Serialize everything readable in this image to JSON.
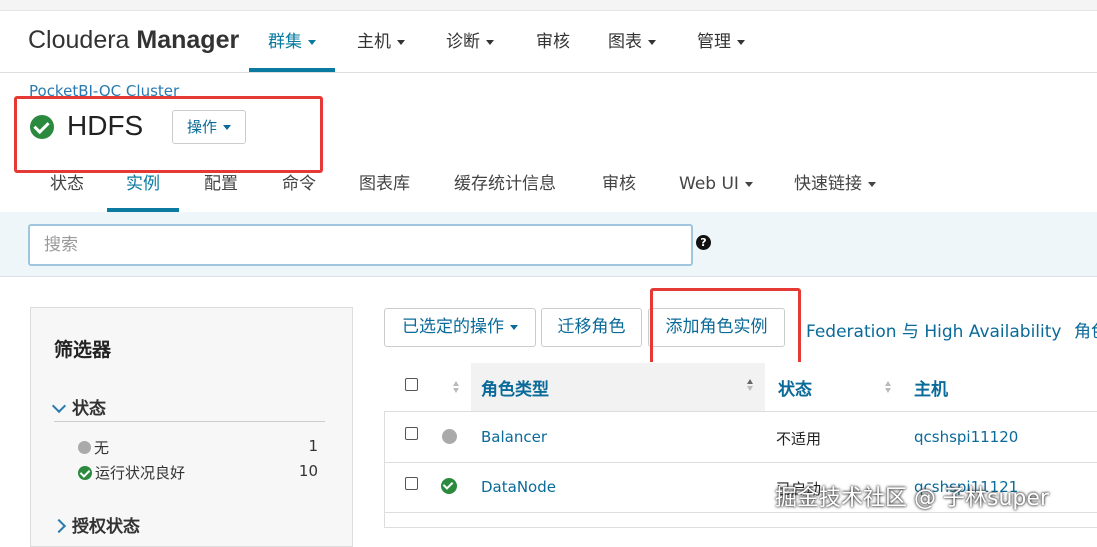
{
  "header": {
    "brand_light": "Cloudera ",
    "brand_bold": "Manager",
    "nav": [
      "群集",
      "主机",
      "诊断",
      "审核",
      "图表",
      "管理"
    ]
  },
  "service": {
    "breadcrumb": "PocketBI-QC Cluster",
    "title": "HDFS",
    "actions_label": "操作"
  },
  "tabs": [
    "状态",
    "实例",
    "配置",
    "命令",
    "图表库",
    "缓存统计信息",
    "审核",
    "Web UI",
    "快速链接"
  ],
  "search": {
    "placeholder": "搜索"
  },
  "filters": {
    "title": "筛选器",
    "sections": [
      {
        "label": "状态",
        "items": [
          {
            "label": "无",
            "count": "1"
          },
          {
            "label": "运行状况良好",
            "count": "10"
          }
        ]
      },
      {
        "label": "授权状态"
      }
    ]
  },
  "toolbar": {
    "selected_ops": "已选定的操作",
    "migrate_role": "迁移角色",
    "add_role_instance": "添加角色实例",
    "federation": "Federation 与 High Availability",
    "role_groups_partial": "角色"
  },
  "table": {
    "columns": [
      "角色类型",
      "状态",
      "主机"
    ],
    "rows": [
      {
        "status_icon": "gray-dot-icon",
        "role_type": "Balancer",
        "state": "不适用",
        "host": "qcshspi11120"
      },
      {
        "status_icon": "ok-check-icon",
        "role_type": "DataNode",
        "state": "已启动",
        "host": "qcshspi11121"
      }
    ]
  },
  "watermark": "掘金技术社区 @ 子林super",
  "colors": {
    "accent": "#0a7aa0",
    "link": "#0a6a99",
    "ok": "#2b8a3e",
    "highlight": "#e53935"
  }
}
